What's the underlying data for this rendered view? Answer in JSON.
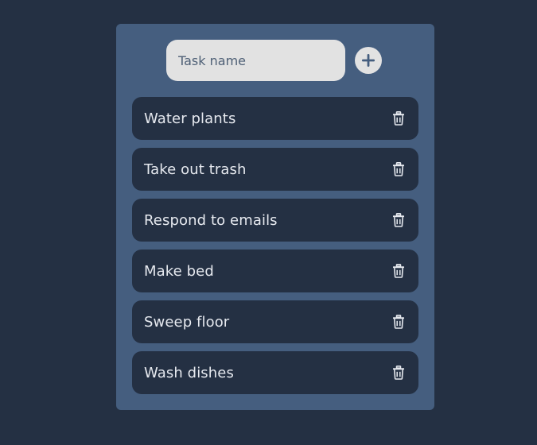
{
  "new_task": {
    "placeholder": "Task name",
    "value": "",
    "add_icon": "plus-icon"
  },
  "tasks": [
    {
      "label": "Water plants",
      "delete_icon": "trash-icon"
    },
    {
      "label": "Take out trash",
      "delete_icon": "trash-icon"
    },
    {
      "label": "Respond to emails",
      "delete_icon": "trash-icon"
    },
    {
      "label": "Make bed",
      "delete_icon": "trash-icon"
    },
    {
      "label": "Sweep floor",
      "delete_icon": "trash-icon"
    },
    {
      "label": "Wash dishes",
      "delete_icon": "trash-icon"
    }
  ],
  "colors": {
    "background": "#243043",
    "panel": "#455e7f",
    "item": "#243043",
    "input": "#e2e2e2",
    "text": "#e6e9ef"
  }
}
